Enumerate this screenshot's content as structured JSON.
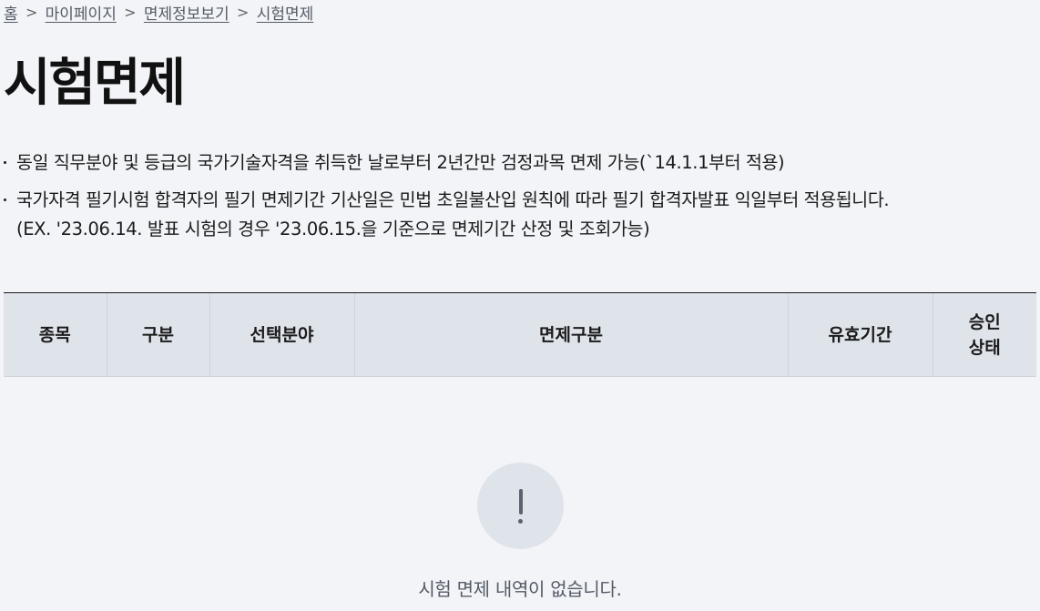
{
  "breadcrumb": [
    {
      "label": "홈"
    },
    {
      "label": "마이페이지"
    },
    {
      "label": "면제정보보기"
    },
    {
      "label": "시험면제"
    }
  ],
  "breadcrumb_separator": ">",
  "page_title": "시험면제",
  "notices": [
    {
      "lines": [
        "동일 직무분야 및 등급의 국가기술자격을 취득한 날로부터 2년간만 검정과목 면제 가능(`14.1.1부터 적용)"
      ]
    },
    {
      "lines": [
        "국가자격 필기시험 합격자의 필기 면제기간 기산일은 민법 초일불산입 원칙에 따라 필기 합격자발표 익일부터 적용됩니다.",
        "(EX. '23.06.14. 발표 시험의 경우 '23.06.15.을 기준으로 면제기간 산정 및 조회가능)"
      ]
    }
  ],
  "table": {
    "columns": [
      {
        "label": "종목"
      },
      {
        "label": "구분"
      },
      {
        "label": "선택분야"
      },
      {
        "label": "면제구분"
      },
      {
        "label": "유효기간"
      },
      {
        "label": "승인\n상태"
      }
    ],
    "rows": []
  },
  "empty_state": {
    "icon": "exclamation-icon",
    "message": "시험 면제 내역이 없습니다."
  },
  "colors": {
    "background": "#f2f4f8",
    "header_background": "#dfe3ea",
    "text": "#1b1b1b",
    "muted_text": "#555b66"
  }
}
